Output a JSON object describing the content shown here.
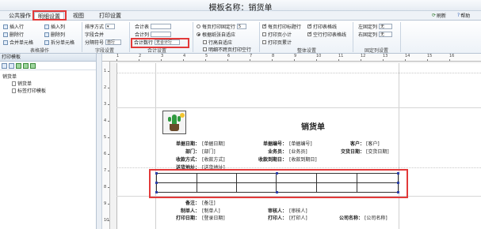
{
  "window": {
    "title": "模板名称：销货单"
  },
  "tabs": [
    {
      "label": "公共操作"
    },
    {
      "label": "明细设置"
    },
    {
      "label": "视图"
    },
    {
      "label": "打印设置"
    }
  ],
  "top_right": {
    "refresh": "刷新",
    "help": "帮助"
  },
  "ribbon": {
    "table_ops": {
      "insert_row": "插入行",
      "insert_col": "插入列",
      "delete_row": "删除行",
      "delete_col": "删除列",
      "merge_cells": "合并单元格",
      "split_cells": "拆分单元格",
      "caption": "表格操作"
    },
    "field_settings": {
      "sort_label": "排序方式",
      "field_merge_label": "字段合并",
      "group_label": "分隔符号",
      "group_value": "自行",
      "caption": "字段设置"
    },
    "total_settings": {
      "total_table": "合计表",
      "total_col": "合计列",
      "total_count_label": "合计数行",
      "total_count_value": "无合计行",
      "caption": "合计设置"
    },
    "print_rows": {
      "fixed_rows_label": "每页打印固定行",
      "fixed_rows_value": "5",
      "auto_fit": "根据纸张自适应",
      "row_height_auto": "行高自适应",
      "detail_no_split": "明细不跨页打印空行"
    },
    "overall": {
      "print_header_each": "每页打印标题行",
      "print_subtotal": "打印页小计",
      "print_total": "打印页累计",
      "print_grid": "打印表格线",
      "blank_grid": "空行打印表格线",
      "caption": "整体设置"
    },
    "fixed_cols": {
      "left_label": "左固定列",
      "left_value": "无",
      "right_label": "右固定列",
      "right_value": "无",
      "caption": "固定列设置"
    }
  },
  "left_panel": {
    "header": "打印模板",
    "tree": [
      {
        "label": "销货单",
        "level": 0
      },
      {
        "label": "销货单",
        "level": 1
      },
      {
        "label": "标签打印模板",
        "level": 1
      }
    ]
  },
  "ruler": {
    "h_marks": [
      "1",
      "2",
      "3",
      "4",
      "5",
      "6",
      "7",
      "8",
      "9",
      "10",
      "11",
      "12",
      "13",
      "14",
      "15",
      "16"
    ],
    "v_marks": [
      "1",
      "2",
      "3",
      "4",
      "5",
      "6",
      "7",
      "8",
      "9",
      "10"
    ]
  },
  "report": {
    "title": "销货单",
    "fields": [
      {
        "label": "单据日期：",
        "value": "[单据日期]"
      },
      {
        "label": "单据编号：",
        "value": "[单据编号]"
      },
      {
        "label": "客户：",
        "value": "[客户]"
      },
      {
        "label": "部门：",
        "value": "[部门]"
      },
      {
        "label": "业务员：",
        "value": "[业务员]"
      },
      {
        "label": "交货日期：",
        "value": "[交货日期]"
      },
      {
        "label": "收款方式：",
        "value": "[收款方式]"
      },
      {
        "label": "收款到期日：",
        "value": "[收款到期日]"
      },
      {
        "label": "送货地址：",
        "value": "[送货地址]"
      }
    ],
    "footer": [
      {
        "label": "备注：",
        "value": "[备注]"
      },
      {
        "label": "制单人：",
        "value": "[制单人]"
      },
      {
        "label": "审核人：",
        "value": "[审核人]"
      },
      {
        "label": "打印日期：",
        "value": "[登录日期]"
      },
      {
        "label": "打印人：",
        "value": "[打印人]"
      },
      {
        "label": "公司名称：",
        "value": "[公司名称]"
      }
    ]
  },
  "colors": {
    "highlight": "#e23a3a",
    "handle": "#2c3fa8",
    "logo_green": "#2f9a3f"
  }
}
